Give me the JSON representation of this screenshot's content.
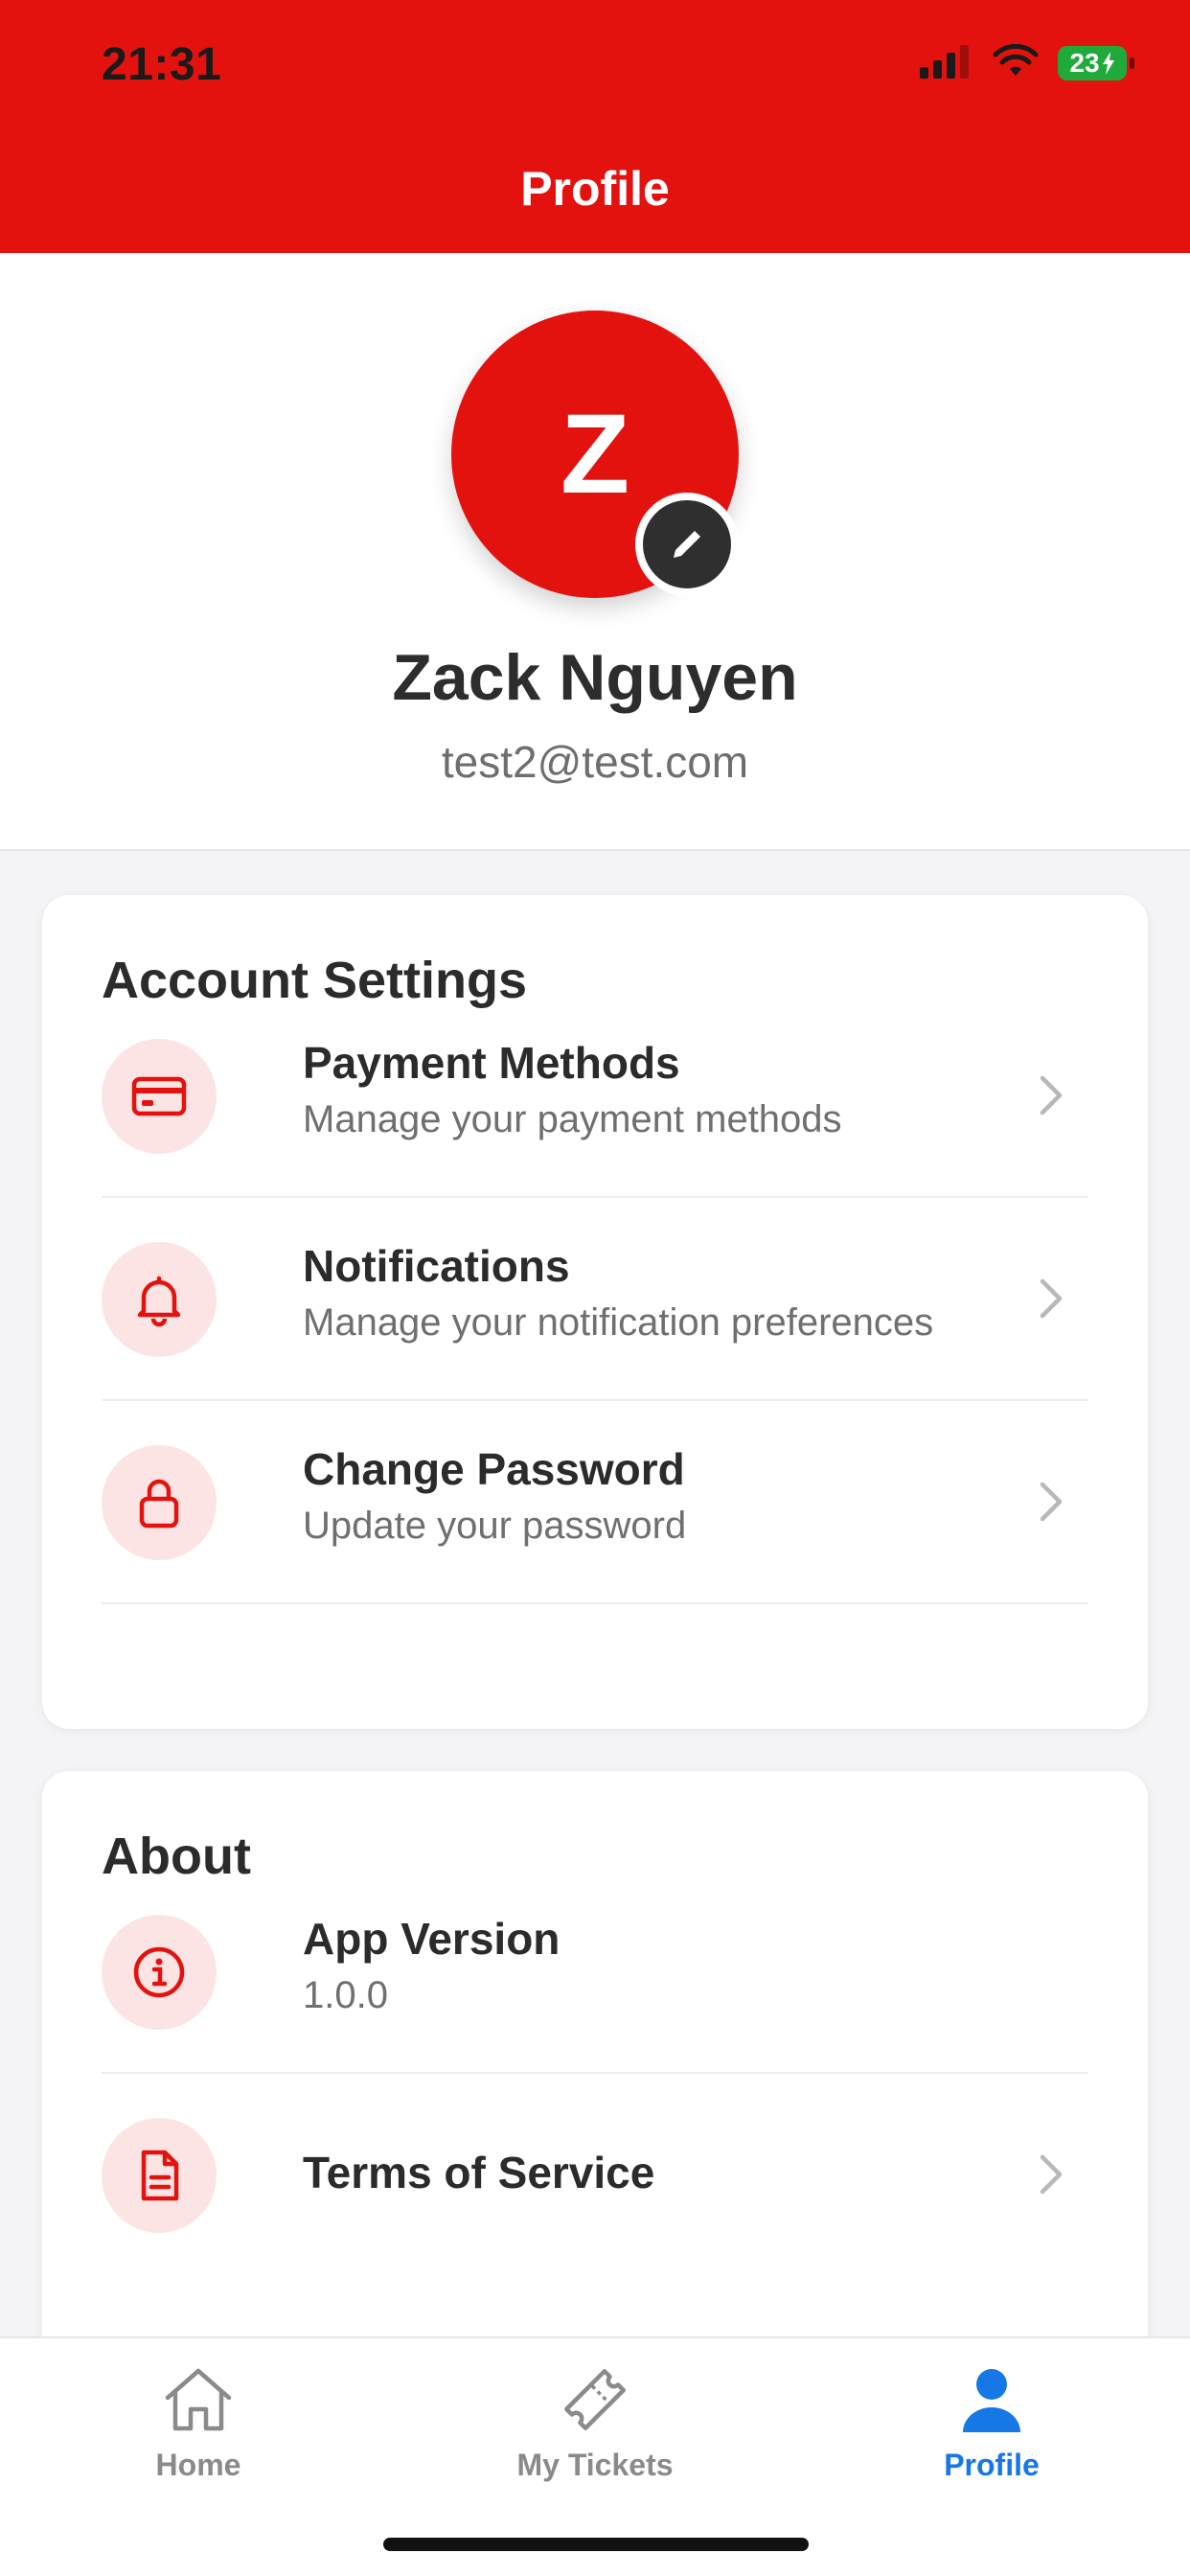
{
  "status_bar": {
    "time": "21:31",
    "battery_level": "23"
  },
  "header": {
    "title": "Profile"
  },
  "profile": {
    "avatar_initial": "Z",
    "name": "Zack Nguyen",
    "email": "test2@test.com"
  },
  "account_settings": {
    "title": "Account Settings",
    "items": [
      {
        "title": "Payment Methods",
        "subtitle": "Manage your payment methods",
        "icon": "credit-card-icon"
      },
      {
        "title": "Notifications",
        "subtitle": "Manage your notification preferences",
        "icon": "bell-icon"
      },
      {
        "title": "Change Password",
        "subtitle": "Update your password",
        "icon": "lock-icon"
      }
    ]
  },
  "about": {
    "title": "About",
    "items": [
      {
        "title": "App Version",
        "subtitle": "1.0.0",
        "icon": "info-icon"
      },
      {
        "title": "Terms of Service",
        "icon": "document-icon"
      }
    ]
  },
  "tabbar": {
    "tabs": [
      {
        "label": "Home",
        "icon": "home-icon",
        "active": false
      },
      {
        "label": "My Tickets",
        "icon": "ticket-icon",
        "active": false
      },
      {
        "label": "Profile",
        "icon": "person-icon",
        "active": true
      }
    ]
  },
  "colors": {
    "brand_red": "#e3120f",
    "icon_bg_pink": "#fde4e4",
    "active_tab_blue": "#1677e6",
    "battery_green": "#1faa3a"
  }
}
